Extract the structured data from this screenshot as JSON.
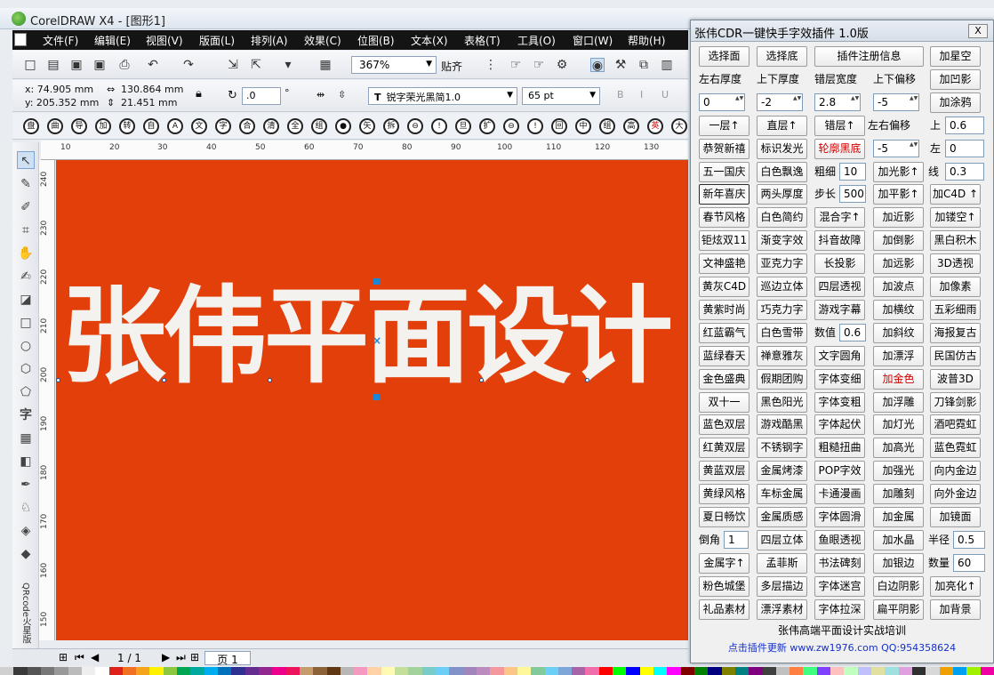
{
  "window_title": "CorelDRAW X4 - [图形1]",
  "menu": [
    "文件(F)",
    "编辑(E)",
    "视图(V)",
    "版面(L)",
    "排列(A)",
    "效果(C)",
    "位图(B)",
    "文本(X)",
    "表格(T)",
    "工具(O)",
    "窗口(W)",
    "帮助(H)"
  ],
  "toolbar": {
    "zoom": "367%",
    "snap_label": "贴齐"
  },
  "props": {
    "x": "x: 74.905 mm",
    "y": "y: 205.352 mm",
    "w": "130.864 mm",
    "h": "21.451 mm",
    "rotation": ".0",
    "font": "锐字荣光黑简1.0",
    "size": "65 pt"
  },
  "glyphs": [
    "盘",
    "曲",
    "导",
    "加",
    "转",
    "自",
    "A",
    "文",
    "字",
    "合",
    "清",
    "全",
    "组",
    "●",
    "矢",
    "拆",
    "⊖",
    "!",
    "旦",
    "扩",
    "⊖",
    "!",
    "回",
    "中",
    "组",
    "高",
    "英",
    "大"
  ],
  "toolbox_label": "QRcode火星版",
  "ruler_h": [
    "10",
    "20",
    "30",
    "40",
    "50",
    "60",
    "70",
    "80",
    "90",
    "100",
    "110",
    "120",
    "130"
  ],
  "ruler_v": [
    "240",
    "230",
    "220",
    "210",
    "200",
    "190",
    "180",
    "170",
    "160",
    "150"
  ],
  "canvas": {
    "text": "张伟平面设计",
    "bg_color": "#e23f0b",
    "text_color": "#f4f2ee"
  },
  "pagebar": {
    "counter": "1 / 1",
    "page_tab": "页 1"
  },
  "plugin": {
    "title": "张伟CDR一键快手字效插件 1.0版",
    "close_label": "X",
    "r1": [
      "选择面",
      "选择底",
      "插件注册信息",
      "加星空"
    ],
    "r2_labels": [
      "左右厚度",
      "上下厚度",
      "错层宽度",
      "上下偏移"
    ],
    "r2_btn": "加凹影",
    "r3_vals": [
      "0",
      "-2",
      "2.8",
      "-5"
    ],
    "r3_btn": "加涂鸦",
    "r4": [
      "一层↑",
      "直层↑",
      "错层↑"
    ],
    "r4_label": "左右偏移",
    "r4_shang": "上",
    "r4_val": "0.6",
    "r5": [
      "恭贺新禧",
      "标识发光",
      "轮廓黑底"
    ],
    "r5_val": "-5",
    "r5_zuo": "左",
    "r5_zuo_val": "0",
    "r6": [
      "五一国庆",
      "白色飘逸"
    ],
    "r6_lbl": "粗细",
    "r6_val": "10",
    "r6_btn": "加光影↑",
    "r6_xian": "线",
    "r6_xian_val": "0.3",
    "r7": [
      "新年喜庆",
      "两头厚度"
    ],
    "r7_lbl": "步长",
    "r7_val": "500",
    "r7_btn": "加平影↑",
    "r7_btn2": "加C4D ↑",
    "grid": [
      [
        "春节风格",
        "白色简约",
        "混合字↑",
        "加近影",
        "加镂空↑"
      ],
      [
        "钜炫双11",
        "渐变字效",
        "抖音故障",
        "加倒影",
        "黑白积木"
      ],
      [
        "文神盛艳",
        "亚克力字",
        "长投影",
        "加远影",
        "3D透视"
      ],
      [
        "黄灰C4D",
        "巡边立体",
        "四层透视",
        "加波点",
        "加像素"
      ],
      [
        "黄紫时尚",
        "巧克力字",
        "游戏字幕",
        "加横纹",
        "五彩细雨"
      ],
      [
        "红蓝霸气",
        "白色雪带",
        "",
        "加斜纹",
        "海报复古"
      ],
      [
        "蓝绿春天",
        "禅意雅灰",
        "文字圆角",
        "加漂浮",
        "民国仿古"
      ],
      [
        "金色盛典",
        "假期团购",
        "字体变细",
        "加金色",
        "波普3D"
      ],
      [
        "双十一",
        "黑色阳光",
        "字体变粗",
        "加浮雕",
        "刀锋剑影"
      ],
      [
        "蓝色双层",
        "游戏酷黑",
        "字体起伏",
        "加灯光",
        "酒吧霓虹"
      ],
      [
        "红黄双层",
        "不锈钢字",
        "粗糙扭曲",
        "加高光",
        "蓝色霓虹"
      ],
      [
        "黄蓝双层",
        "金属烤漆",
        "POP字效",
        "加强光",
        "向内金边"
      ],
      [
        "黄绿风格",
        "车标金属",
        "卡通漫画",
        "加雕刻",
        "向外金边"
      ],
      [
        "夏日畅饮",
        "金属质感",
        "字体圆滑",
        "加金属",
        "加镜面"
      ]
    ],
    "shuzhi_lbl": "数值",
    "shuzhi_val": "0.6",
    "r_daojiao_lbl": "倒角",
    "r_daojiao_val": "1",
    "r_daojiao_btns": [
      "四层立体",
      "鱼眼透视",
      "加水晶"
    ],
    "r_banjing": "半径",
    "r_banjing_val": "0.5",
    "r_last1": [
      "金属字↑",
      "孟菲斯",
      "书法碑刻",
      "加银边"
    ],
    "r_shuliang": "数量",
    "r_shuliang_val": "60",
    "r_last2": [
      "粉色城堡",
      "多层描边",
      "字体迷宫",
      "白边阴影",
      "加亮化↑"
    ],
    "r_last3": [
      "礼品素材",
      "漂浮素材",
      "字体拉深",
      "扁平阴影",
      "加背景"
    ],
    "footer": "张伟高端平面设计实战培训",
    "link": "点击插件更新 www.zw1976.com    QQ:954358624"
  }
}
